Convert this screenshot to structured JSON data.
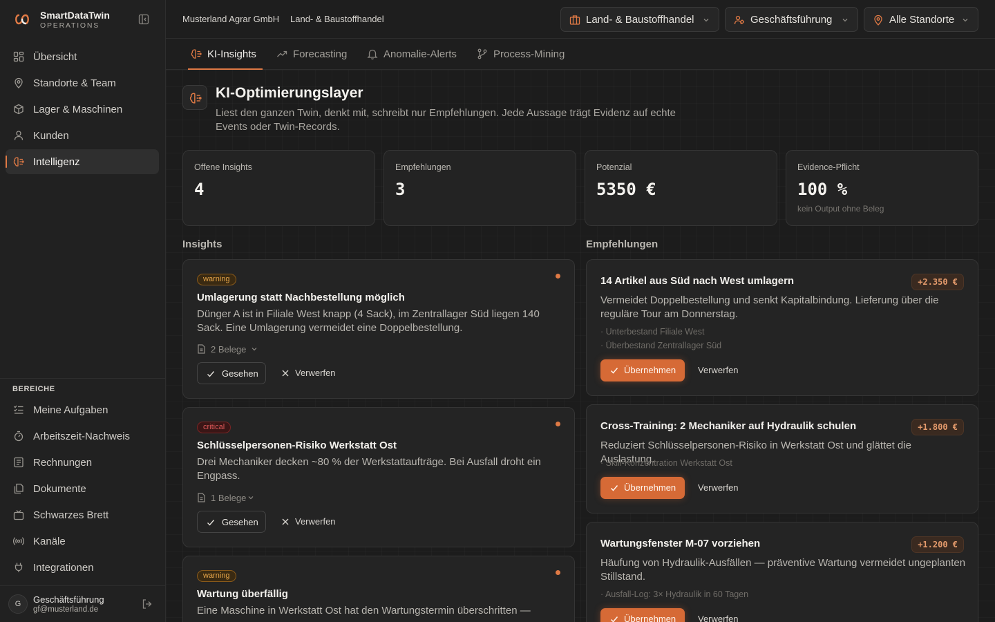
{
  "brand": {
    "name": "SmartDataTwin",
    "sub": "OPERATIONS"
  },
  "nav": {
    "items": [
      {
        "label": "Übersicht",
        "icon": "grid-icon"
      },
      {
        "label": "Standorte & Team",
        "icon": "map-pin-icon"
      },
      {
        "label": "Lager & Maschinen",
        "icon": "box-icon"
      },
      {
        "label": "Kunden",
        "icon": "user-icon"
      },
      {
        "label": "Intelligenz",
        "icon": "brain-icon",
        "active": true
      }
    ],
    "section_title": "BEREICHE",
    "section_items": [
      {
        "label": "Meine Aufgaben",
        "icon": "list-checks-icon"
      },
      {
        "label": "Arbeitszeit-Nachweis",
        "icon": "timer-icon"
      },
      {
        "label": "Rechnungen",
        "icon": "receipt-icon"
      },
      {
        "label": "Dokumente",
        "icon": "files-icon"
      },
      {
        "label": "Schwarzes Brett",
        "icon": "tv-icon"
      },
      {
        "label": "Kanäle",
        "icon": "radio-icon"
      },
      {
        "label": "Integrationen",
        "icon": "plug-icon"
      }
    ]
  },
  "user": {
    "initial": "G",
    "name": "Geschäftsführung",
    "email": "gf@musterland.de"
  },
  "topbar": {
    "company": "Musterland Agrar GmbH",
    "segment": "Land- & Baustoffhandel",
    "selectors": {
      "branch": "Land- & Baustoffhandel",
      "role": "Geschäftsführung",
      "location": "Alle Standorte"
    }
  },
  "tabs": [
    {
      "label": "KI-Insights",
      "icon": "brain-icon",
      "active": true
    },
    {
      "label": "Forecasting",
      "icon": "trending-up-icon"
    },
    {
      "label": "Anomalie-Alerts",
      "icon": "bell-icon"
    },
    {
      "label": "Process-Mining",
      "icon": "git-branch-icon"
    }
  ],
  "page": {
    "title": "KI-Optimierungslayer",
    "subtitle": "Liest den ganzen Twin, denkt mit, schreibt nur Empfehlungen. Jede Aussage trägt Evidenz auf echte Events oder Twin-Records."
  },
  "stats": [
    {
      "label": "Offene Insights",
      "value": "4",
      "note": ""
    },
    {
      "label": "Empfehlungen",
      "value": "3",
      "note": ""
    },
    {
      "label": "Potenzial",
      "value": "5350 €",
      "note": ""
    },
    {
      "label": "Evidence-Pflicht",
      "value": "100 %",
      "note": "kein Output ohne Beleg"
    }
  ],
  "insights_heading": "Insights",
  "recommendations_heading": "Empfehlungen",
  "insights": [
    {
      "severity": "warning",
      "title": "Umlagerung statt Nachbestellung möglich",
      "text": "Dünger A ist in Filiale West knapp (4 Sack), im Zentrallager Süd liegen 140 Sack. Eine Umlagerung vermeidet eine Doppelbestellung.",
      "evidence": "2 Belege",
      "seen": "Gesehen",
      "dismiss": "Verwerfen"
    },
    {
      "severity": "critical",
      "title": "Schlüsselpersonen-Risiko Werkstatt Ost",
      "text": "Drei Mechaniker decken ~80 % der Werkstattaufträge. Bei Ausfall droht ein Engpass.",
      "evidence": "1 Belege",
      "seen": "Gesehen",
      "dismiss": "Verwerfen"
    },
    {
      "severity": "warning",
      "title": "Wartung überfällig",
      "text": "Eine Maschine in Werkstatt Ost hat den Wartungstermin überschritten —",
      "evidence": "",
      "seen": "",
      "dismiss": ""
    }
  ],
  "recommendations": [
    {
      "title": "14 Artikel aus Süd nach West umlagern",
      "impact": "+2.350 €",
      "text": "Vermeidet Doppelbestellung und senkt Kapitalbindung. Lieferung über die reguläre Tour am Donnerstag.",
      "evidence": [
        "· Unterbestand Filiale West",
        "· Überbestand Zentrallager Süd"
      ],
      "accept": "Übernehmen",
      "dismiss": "Verwerfen"
    },
    {
      "title": "Cross-Training: 2 Mechaniker auf Hydraulik schulen",
      "impact": "+1.800 €",
      "text": "Reduziert Schlüsselpersonen-Risiko in Werkstatt Ost und glättet die Auslastung.",
      "evidence": [
        "· Skill-Konzentration Werkstatt Ost"
      ],
      "accept": "Übernehmen",
      "dismiss": "Verwerfen"
    },
    {
      "title": "Wartungsfenster M-07 vorziehen",
      "impact": "+1.200 €",
      "text": "Häufung von Hydraulik-Ausfällen — präventive Wartung vermeidet ungeplanten Stillstand.",
      "evidence": [
        "· Ausfall-Log: 3× Hydraulik in 60 Tagen"
      ],
      "accept": "Übernehmen",
      "dismiss": "Verwerfen"
    }
  ],
  "colors": {
    "accent": "#e07a45",
    "primary_button": "#d66a36",
    "warning": "#e7a64a",
    "critical": "#e05a5a"
  }
}
